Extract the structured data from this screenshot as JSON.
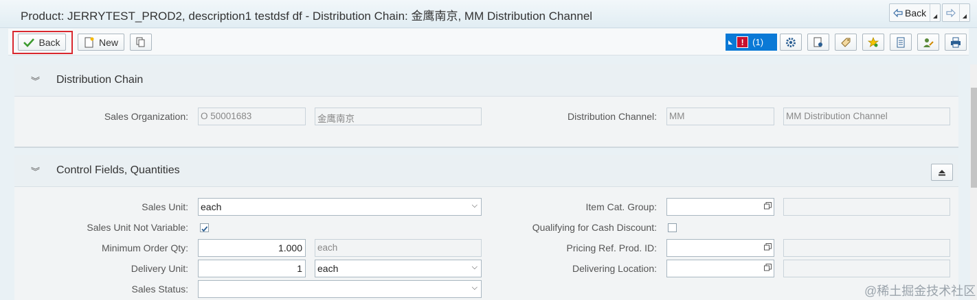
{
  "header": {
    "title": "Product: JERRYTEST_PROD2, description1 testdsf df - Distribution Chain: 金鹰南京, MM Distribution Channel",
    "nav_back_label": "Back"
  },
  "toolbar": {
    "back_label": "Back",
    "new_label": "New",
    "message_count": "(1)"
  },
  "sections": {
    "distribution_chain": {
      "title": "Distribution Chain",
      "sales_org_label": "Sales Organization:",
      "sales_org_value": "O 50001683",
      "sales_org_desc": "金鹰南京",
      "dist_channel_label": "Distribution Channel:",
      "dist_channel_value": "MM",
      "dist_channel_desc": "MM Distribution Channel"
    },
    "control_fields": {
      "title": "Control Fields, Quantities",
      "sales_unit_label": "Sales Unit:",
      "sales_unit_value": "each",
      "sales_unit_not_variable_label": "Sales Unit Not Variable:",
      "sales_unit_not_variable_checked": true,
      "min_order_qty_label": "Minimum Order Qty:",
      "min_order_qty_value": "1.000",
      "min_order_qty_unit": "each",
      "delivery_unit_label": "Delivery Unit:",
      "delivery_unit_value": "1",
      "delivery_unit_unit": "each",
      "sales_status_label": "Sales Status:",
      "sales_status_value": "",
      "item_cat_group_label": "Item Cat. Group:",
      "item_cat_group_value": "",
      "cash_discount_label": "Qualifying for Cash Discount:",
      "cash_discount_checked": false,
      "pricing_ref_label": "Pricing Ref. Prod. ID:",
      "pricing_ref_value": "",
      "delivering_location_label": "Delivering Location:",
      "delivering_location_value": ""
    }
  },
  "watermark": "@稀土掘金技术社区",
  "colors": {
    "message_button": "#0a79d6",
    "error_indicator": "#c8102e",
    "highlight_border": "#d9272e"
  }
}
